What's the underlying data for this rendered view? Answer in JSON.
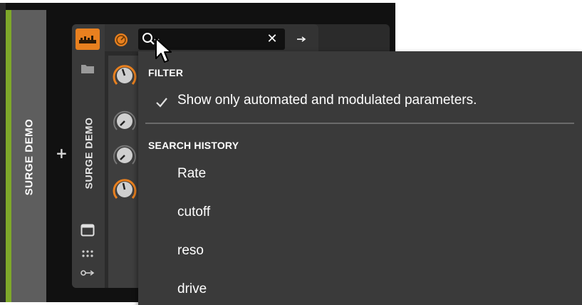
{
  "track": {
    "name": "SURGE DEMO"
  },
  "device": {
    "name": "SURGE DEMO"
  },
  "search": {
    "value": "",
    "placeholder": ""
  },
  "dropdown": {
    "filter_header": "FILTER",
    "filter_option": "Show only automated and modulated parameters.",
    "filter_option_checked": true,
    "history_header": "SEARCH HISTORY",
    "history_items": [
      {
        "label": "Rate"
      },
      {
        "label": "cutoff"
      },
      {
        "label": "reso"
      },
      {
        "label": "drive"
      }
    ]
  },
  "colors": {
    "accent": "#e8801f",
    "track_green": "#7ea72a"
  }
}
